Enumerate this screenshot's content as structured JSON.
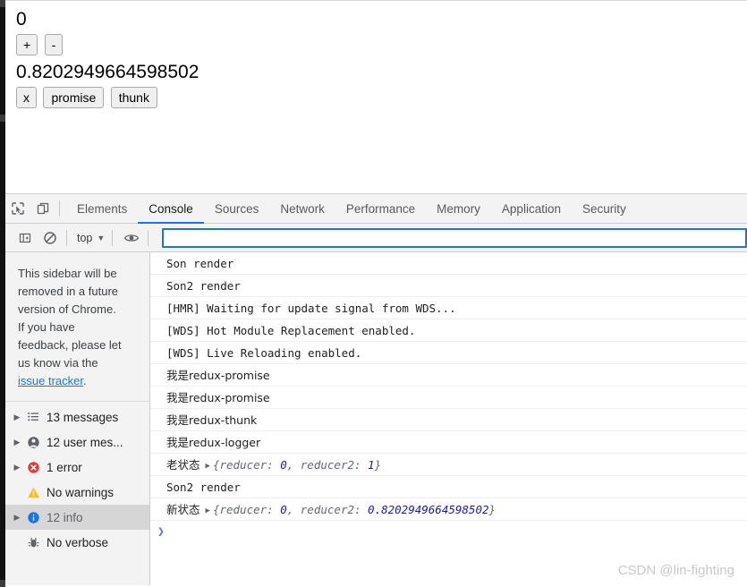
{
  "page": {
    "counter_value": "0",
    "increment_label": "+",
    "decrement_label": "-",
    "random_value": "0.8202949664598502",
    "x_label": "x",
    "promise_label": "promise",
    "thunk_label": "thunk"
  },
  "devtools": {
    "tabs": [
      {
        "label": "Elements",
        "active": false
      },
      {
        "label": "Console",
        "active": true
      },
      {
        "label": "Sources",
        "active": false
      },
      {
        "label": "Network",
        "active": false
      },
      {
        "label": "Performance",
        "active": false
      },
      {
        "label": "Memory",
        "active": false
      },
      {
        "label": "Application",
        "active": false
      },
      {
        "label": "Security",
        "active": false
      }
    ],
    "filterbar": {
      "context": "top",
      "context_caret": "▼",
      "filter_value": "",
      "filter_placeholder": ""
    },
    "sidebar": {
      "notice_line1": "This sidebar will be",
      "notice_line2": "removed in a future",
      "notice_line3": "version of Chrome.",
      "notice_line4": "If you have",
      "notice_line5": "feedback, please let",
      "notice_line6": "us know via the",
      "notice_link": "issue tracker",
      "notice_period": ".",
      "items": [
        {
          "label": "13 messages",
          "icon": "list-icon",
          "expandable": true,
          "selected": false
        },
        {
          "label": "12 user mes...",
          "icon": "user-icon",
          "expandable": true,
          "selected": false
        },
        {
          "label": "1 error",
          "icon": "error-icon",
          "expandable": true,
          "selected": false
        },
        {
          "label": "No warnings",
          "icon": "warning-icon",
          "expandable": false,
          "selected": false
        },
        {
          "label": "12 info",
          "icon": "info-icon",
          "expandable": true,
          "selected": true
        },
        {
          "label": "No verbose",
          "icon": "bug-icon",
          "expandable": false,
          "selected": false
        }
      ]
    },
    "console": {
      "messages": [
        {
          "text": "Son render"
        },
        {
          "text": "Son2 render"
        },
        {
          "text": "[HMR] Waiting for update signal from WDS..."
        },
        {
          "text": "[WDS] Hot Module Replacement enabled."
        },
        {
          "text": "[WDS] Live Reloading enabled."
        },
        {
          "text": "我是redux-promise"
        },
        {
          "text": "我是redux-promise"
        },
        {
          "text": "我是redux-thunk"
        },
        {
          "text": "我是redux-logger"
        },
        {
          "text": "老状态",
          "object_prefix": "{reducer: ",
          "object_v1": "0",
          "object_mid": ", reducer2: ",
          "object_v2": "1",
          "object_suffix": "}"
        },
        {
          "text": "Son2 render"
        },
        {
          "text": "新状态",
          "object_prefix": "{reducer: ",
          "object_v1": "0",
          "object_mid": ", reducer2: ",
          "object_v2": "0.8202949664598502",
          "object_suffix": "}"
        }
      ],
      "prompt_chevron": "❯"
    }
  },
  "watermark": "CSDN @lin-fighting",
  "colors": {
    "accent": "#1a73e8",
    "error": "#e53935",
    "warning": "#f9bc2b",
    "info": "#1a73e8",
    "toolbar_bg": "#f3f3f3"
  }
}
